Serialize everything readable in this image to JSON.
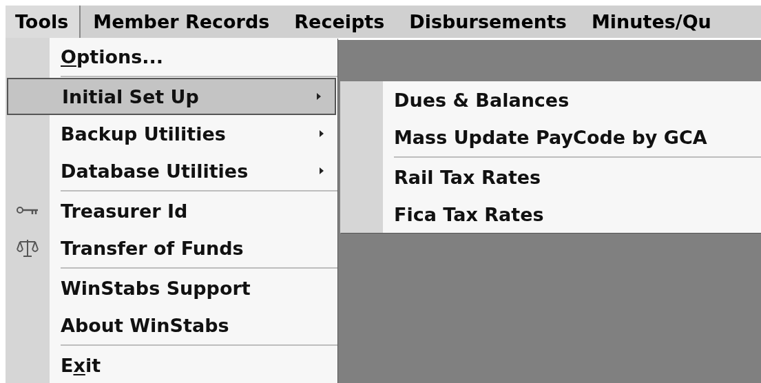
{
  "menu_bar": [
    {
      "label": "Tools",
      "selected": true
    },
    {
      "label": "Member Records",
      "selected": false
    },
    {
      "label": "Receipts",
      "selected": false
    },
    {
      "label": "Disbursements",
      "selected": false
    },
    {
      "label": "Minutes/Qu",
      "selected": false
    }
  ],
  "tools_menu": [
    {
      "kind": "item",
      "mnemonic": "O",
      "suffix": "ptions...",
      "selected": false
    },
    {
      "kind": "separator"
    },
    {
      "kind": "submenu",
      "label": "Initial Set Up",
      "selected": true
    },
    {
      "kind": "submenu",
      "label": "Backup Utilities",
      "selected": false
    },
    {
      "kind": "submenu",
      "label": "Database Utilities",
      "selected": false
    },
    {
      "kind": "separator"
    },
    {
      "kind": "key-item",
      "label": "Treasurer Id",
      "selected": false
    },
    {
      "kind": "scales-item",
      "label": "Transfer of Funds",
      "selected": false
    },
    {
      "kind": "separator"
    },
    {
      "kind": "item",
      "label": "WinStabs Support",
      "selected": false
    },
    {
      "kind": "item",
      "label": "About WinStabs",
      "selected": false
    },
    {
      "kind": "separator"
    },
    {
      "kind": "item",
      "prefix": "E",
      "mnemonic": "x",
      "suffix": "it",
      "selected": false
    }
  ],
  "initial_set_up_menu": [
    {
      "kind": "item",
      "label": "Dues & Balances",
      "selected": false
    },
    {
      "kind": "item",
      "label": "Mass Update PayCode by GCA",
      "selected": false
    },
    {
      "kind": "separator"
    },
    {
      "kind": "item",
      "label": "Rail Tax Rates",
      "selected": false
    },
    {
      "kind": "item",
      "label": "Fica Tax Rates",
      "selected": false
    }
  ]
}
